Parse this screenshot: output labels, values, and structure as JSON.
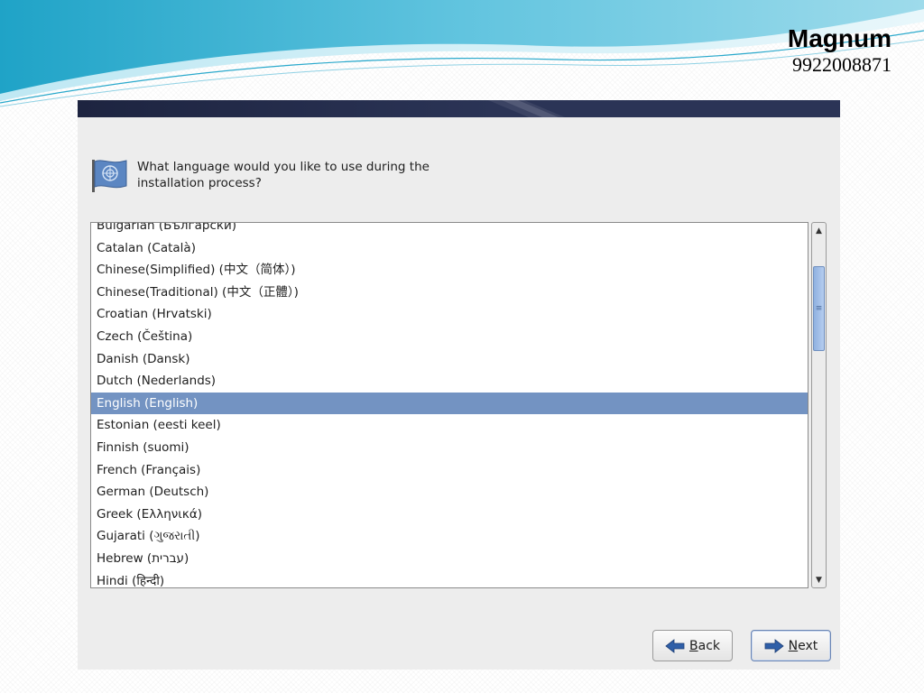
{
  "brand": {
    "name": "Magnum",
    "phone": "9922008871"
  },
  "installer": {
    "question": "What language would you like to use during the installation process?",
    "languages": [
      "Bulgarian (Български)",
      "Catalan (Català)",
      "Chinese(Simplified) (中文（简体）)",
      "Chinese(Traditional) (中文（正體）)",
      "Croatian (Hrvatski)",
      "Czech (Čeština)",
      "Danish (Dansk)",
      "Dutch (Nederlands)",
      "English (English)",
      "Estonian (eesti keel)",
      "Finnish (suomi)",
      "French (Français)",
      "German (Deutsch)",
      "Greek (Ελληνικά)",
      "Gujarati (ગુજરાતી)",
      "Hebrew (עברית)",
      "Hindi (हिन्दी)"
    ],
    "selected_language": "English (English)",
    "buttons": {
      "back_mnemonic": "B",
      "back_rest": "ack",
      "next_mnemonic": "N",
      "next_rest": "ext"
    },
    "icons": {
      "flag": "language-flag-icon",
      "back": "arrow-left-icon",
      "next": "arrow-right-icon"
    },
    "colors": {
      "selection": "#7393c2",
      "banner": "#1d2440",
      "arrow": "#2f5fa8"
    }
  }
}
